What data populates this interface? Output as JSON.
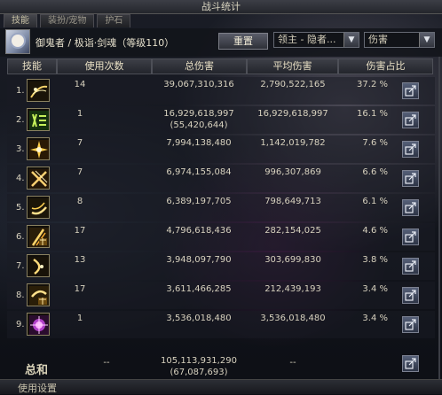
{
  "window": {
    "title": "战斗统计"
  },
  "tabs": [
    "技能",
    "装扮/宠物",
    "护石"
  ],
  "character": {
    "name": "御鬼者 / 极诣·剑魂（等级110）"
  },
  "controls": {
    "reset_label": "重置",
    "target_select": "领主 - 隐者...",
    "metric_select": "伤害"
  },
  "columns": {
    "skill": "技能",
    "uses": "使用次数",
    "total": "总伤害",
    "average": "平均伤害",
    "share": "伤害占比"
  },
  "rows": [
    {
      "index": "1.",
      "icon": "sword-slash-icon",
      "uses": "14",
      "total": "39,067,310,316",
      "total_sub": "",
      "average": "2,790,522,165",
      "percent": "37.2 %"
    },
    {
      "index": "2.",
      "icon": "green-rune-icon",
      "uses": "1",
      "total": "16,929,618,997",
      "total_sub": "(55,420,644)",
      "average": "16,929,618,997",
      "percent": "16.1 %"
    },
    {
      "index": "3.",
      "icon": "lightning-burst-icon",
      "uses": "7",
      "total": "7,994,138,480",
      "total_sub": "",
      "average": "1,142,019,782",
      "percent": "7.6 %"
    },
    {
      "index": "4.",
      "icon": "cross-slash-icon",
      "uses": "7",
      "total": "6,974,155,084",
      "total_sub": "",
      "average": "996,307,869",
      "percent": "6.6 %"
    },
    {
      "index": "5.",
      "icon": "crescent-wave-icon",
      "uses": "8",
      "total": "6,389,197,705",
      "total_sub": "",
      "average": "798,649,713",
      "percent": "6.1 %"
    },
    {
      "index": "6.",
      "icon": "flowing-blade-icon",
      "uses": "17",
      "total": "4,796,618,436",
      "total_sub": "",
      "average": "282,154,025",
      "percent": "4.6 %"
    },
    {
      "index": "7.",
      "icon": "crescent-strike-icon",
      "uses": "13",
      "total": "3,948,097,790",
      "total_sub": "",
      "average": "303,699,830",
      "percent": "3.8 %"
    },
    {
      "index": "8.",
      "icon": "flowing-moon-icon",
      "uses": "17",
      "total": "3,611,466,285",
      "total_sub": "",
      "average": "212,439,193",
      "percent": "3.4 %"
    },
    {
      "index": "9.",
      "icon": "purple-flare-icon",
      "uses": "1",
      "total": "3,536,018,480",
      "total_sub": "",
      "average": "3,536,018,480",
      "percent": "3.4 %"
    }
  ],
  "summary": {
    "label": "总和",
    "uses": "--",
    "total": "105,113,931,290",
    "total_sub": "(67,087,693)",
    "average": "--"
  },
  "bottom": {
    "label": "使用设置"
  },
  "colors": {
    "accent": "#e8dfc4",
    "panel": "#12141a",
    "button": "#566078"
  }
}
